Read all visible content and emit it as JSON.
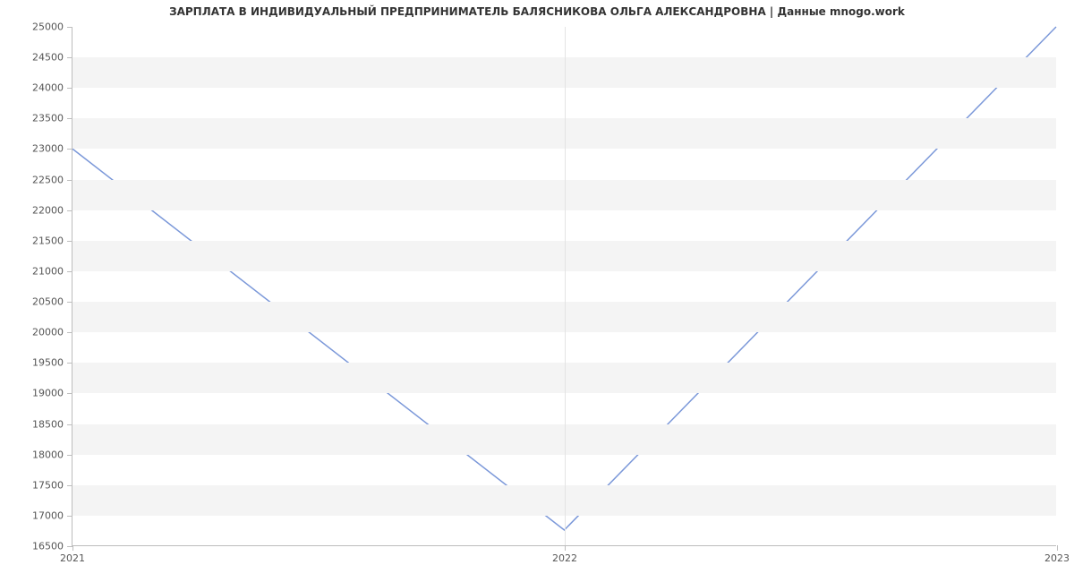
{
  "chart_data": {
    "type": "line",
    "title": "ЗАРПЛАТА В ИНДИВИДУАЛЬНЫЙ ПРЕДПРИНИМАТЕЛЬ БАЛЯСНИКОВА ОЛЬГА АЛЕКСАНДРОВНА | Данные mnogo.work",
    "xlabel": "",
    "ylabel": "",
    "x": [
      2021,
      2022,
      2023
    ],
    "values": [
      23000,
      16750,
      25000
    ],
    "x_ticks": [
      2021,
      2022,
      2023
    ],
    "y_ticks": [
      16500,
      17000,
      17500,
      18000,
      18500,
      19000,
      19500,
      20000,
      20500,
      21000,
      21500,
      22000,
      22500,
      23000,
      23500,
      24000,
      24500,
      25000
    ],
    "xlim": [
      2021,
      2023
    ],
    "ylim": [
      16500,
      25000
    ],
    "line_color": "#7b98d9"
  }
}
